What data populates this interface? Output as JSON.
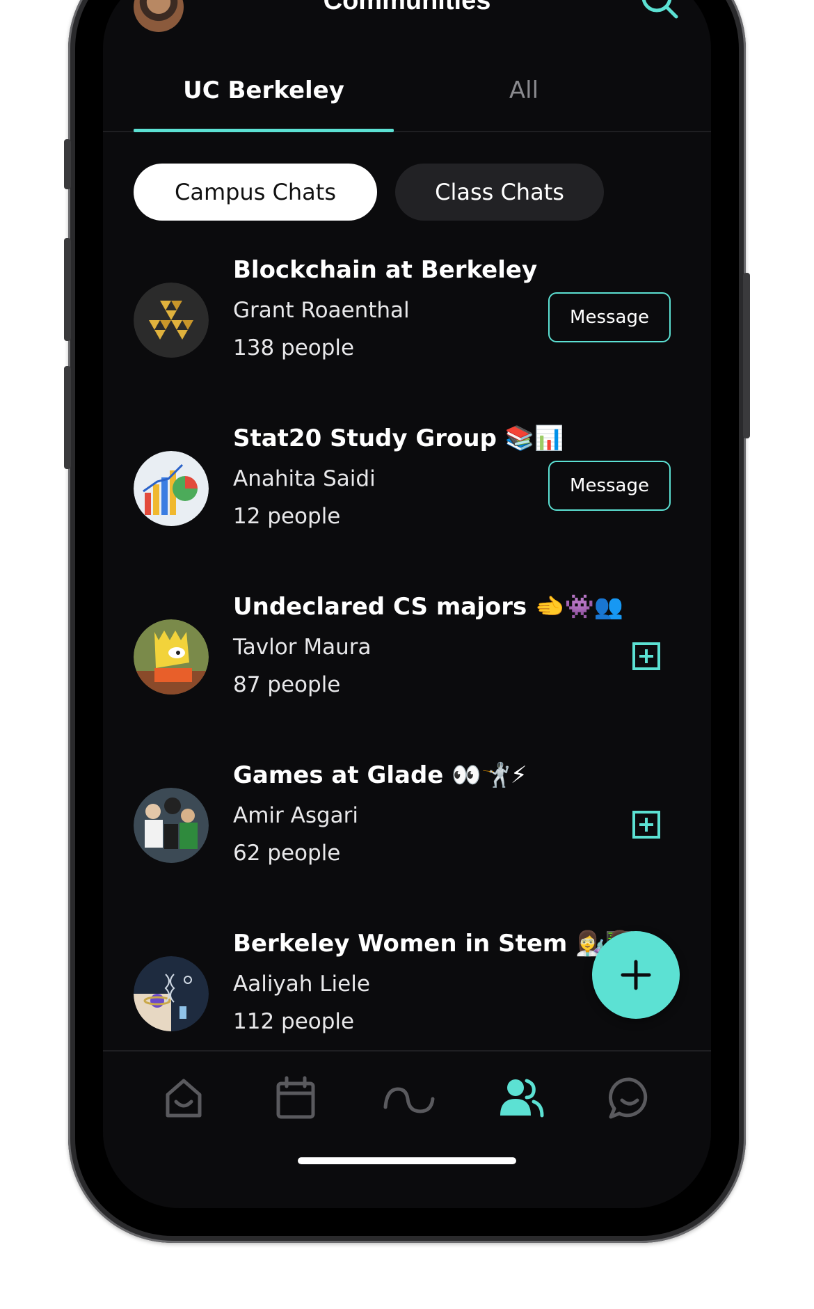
{
  "header": {
    "title": "Communities",
    "avatar_icon": "profile-avatar",
    "search_icon": "search-icon"
  },
  "tabs": [
    {
      "label": "UC Berkeley",
      "active": true
    },
    {
      "label": "All",
      "active": false
    }
  ],
  "chips": [
    {
      "label": "Campus Chats",
      "selected": true
    },
    {
      "label": "Class Chats",
      "selected": false
    }
  ],
  "communities": [
    {
      "name": "Blockchain at Berkeley",
      "emoji": "",
      "owner": "Grant Roaenthal",
      "count": "138 people",
      "action": "Message"
    },
    {
      "name": "Stat20 Study Group",
      "emoji": "📚📊",
      "owner": "Anahita Saidi",
      "count": "12 people",
      "action": "Message"
    },
    {
      "name": "Undeclared CS majors",
      "emoji": "🫲👾👥",
      "owner": "Tavlor Maura",
      "count": "87 people",
      "action": "join"
    },
    {
      "name": "Games at Glade",
      "emoji": "👀🤺⚡",
      "owner": "Amir Asgari",
      "count": "62 people",
      "action": "join"
    },
    {
      "name": "Berkeley Women in Stem",
      "emoji": "👩‍🔬👩‍💻",
      "owner": "Aaliyah Liele",
      "count": "112 people",
      "action": "join"
    }
  ],
  "fab": {
    "icon": "plus-icon"
  },
  "bottom_nav": [
    {
      "icon": "home-icon",
      "active": false
    },
    {
      "icon": "calendar-icon",
      "active": false
    },
    {
      "icon": "wave-icon",
      "active": false
    },
    {
      "icon": "communities-icon",
      "active": true
    },
    {
      "icon": "chat-icon",
      "active": false
    }
  ],
  "colors": {
    "accent": "#5ce1d3",
    "background": "#0b0b0d",
    "inactive": "#8a8a8e"
  }
}
